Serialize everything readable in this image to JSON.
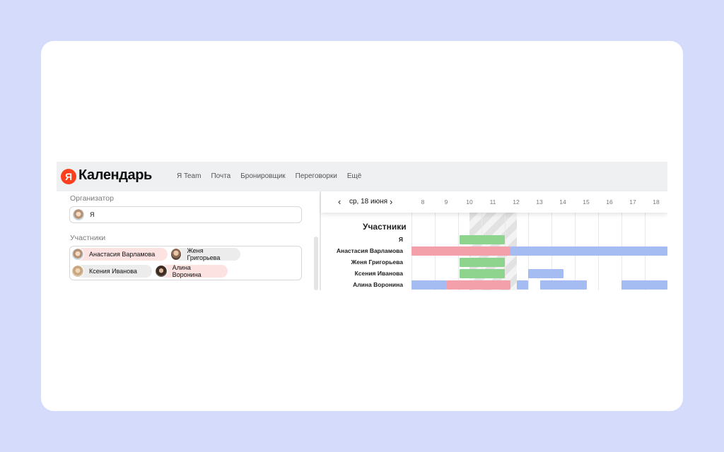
{
  "colors": {
    "background": "#d5dcfb",
    "brand": "#fc3f1d",
    "busy_green": "#8ed48f",
    "busy_pink": "#f3a0aa",
    "busy_blue": "#a4bcf1"
  },
  "header": {
    "logo_letter": "Я",
    "logo_title": "Календарь",
    "nav": [
      "Я Team",
      "Почта",
      "Бронировщик",
      "Переговорки",
      "Ещё"
    ]
  },
  "form": {
    "organizer_label": "Организатор",
    "organizer": {
      "name": "Я",
      "avatar_icon": "user-avatar"
    },
    "participants_label": "Участники",
    "participants": [
      {
        "name": "Анастасия Варламова",
        "highlight": "pink"
      },
      {
        "name": "Женя Григорьева",
        "highlight": "gray"
      },
      {
        "name": "Ксения Иванова",
        "highlight": "gray"
      },
      {
        "name": "Алина Воронина",
        "highlight": "pink"
      }
    ]
  },
  "schedule": {
    "prev_icon": "chevron-left-icon",
    "next_icon": "chevron-right-icon",
    "date": "ср, 18 июня",
    "hours": [
      "8",
      "9",
      "10",
      "11",
      "12",
      "13",
      "14",
      "15",
      "16",
      "17",
      "18"
    ],
    "participants_title": "Участники",
    "rows": [
      {
        "name": "Я",
        "busy": [
          {
            "from": 10.05,
            "to": 12.0,
            "kind": "green"
          }
        ]
      },
      {
        "name": "Анастасия Варламова",
        "busy": [
          {
            "from": 7.5,
            "to": 12.25,
            "kind": "pink"
          },
          {
            "from": 12.25,
            "to": 19.5,
            "kind": "blue"
          }
        ]
      },
      {
        "name": "Женя Григорьева",
        "busy": [
          {
            "from": 10.05,
            "to": 12.0,
            "kind": "green"
          }
        ]
      },
      {
        "name": "Ксения Иванова",
        "busy": [
          {
            "from": 10.05,
            "to": 12.0,
            "kind": "green"
          },
          {
            "from": 13.0,
            "to": 14.5,
            "kind": "blue"
          }
        ]
      },
      {
        "name": "Алина Воронина",
        "busy": [
          {
            "from": 7.5,
            "to": 9.5,
            "kind": "blue"
          },
          {
            "from": 9.5,
            "to": 12.25,
            "kind": "pink"
          },
          {
            "from": 12.5,
            "to": 13.0,
            "kind": "blue"
          },
          {
            "from": 13.5,
            "to": 15.5,
            "kind": "blue"
          },
          {
            "from": 17.0,
            "to": 19.5,
            "kind": "blue"
          }
        ]
      }
    ]
  }
}
